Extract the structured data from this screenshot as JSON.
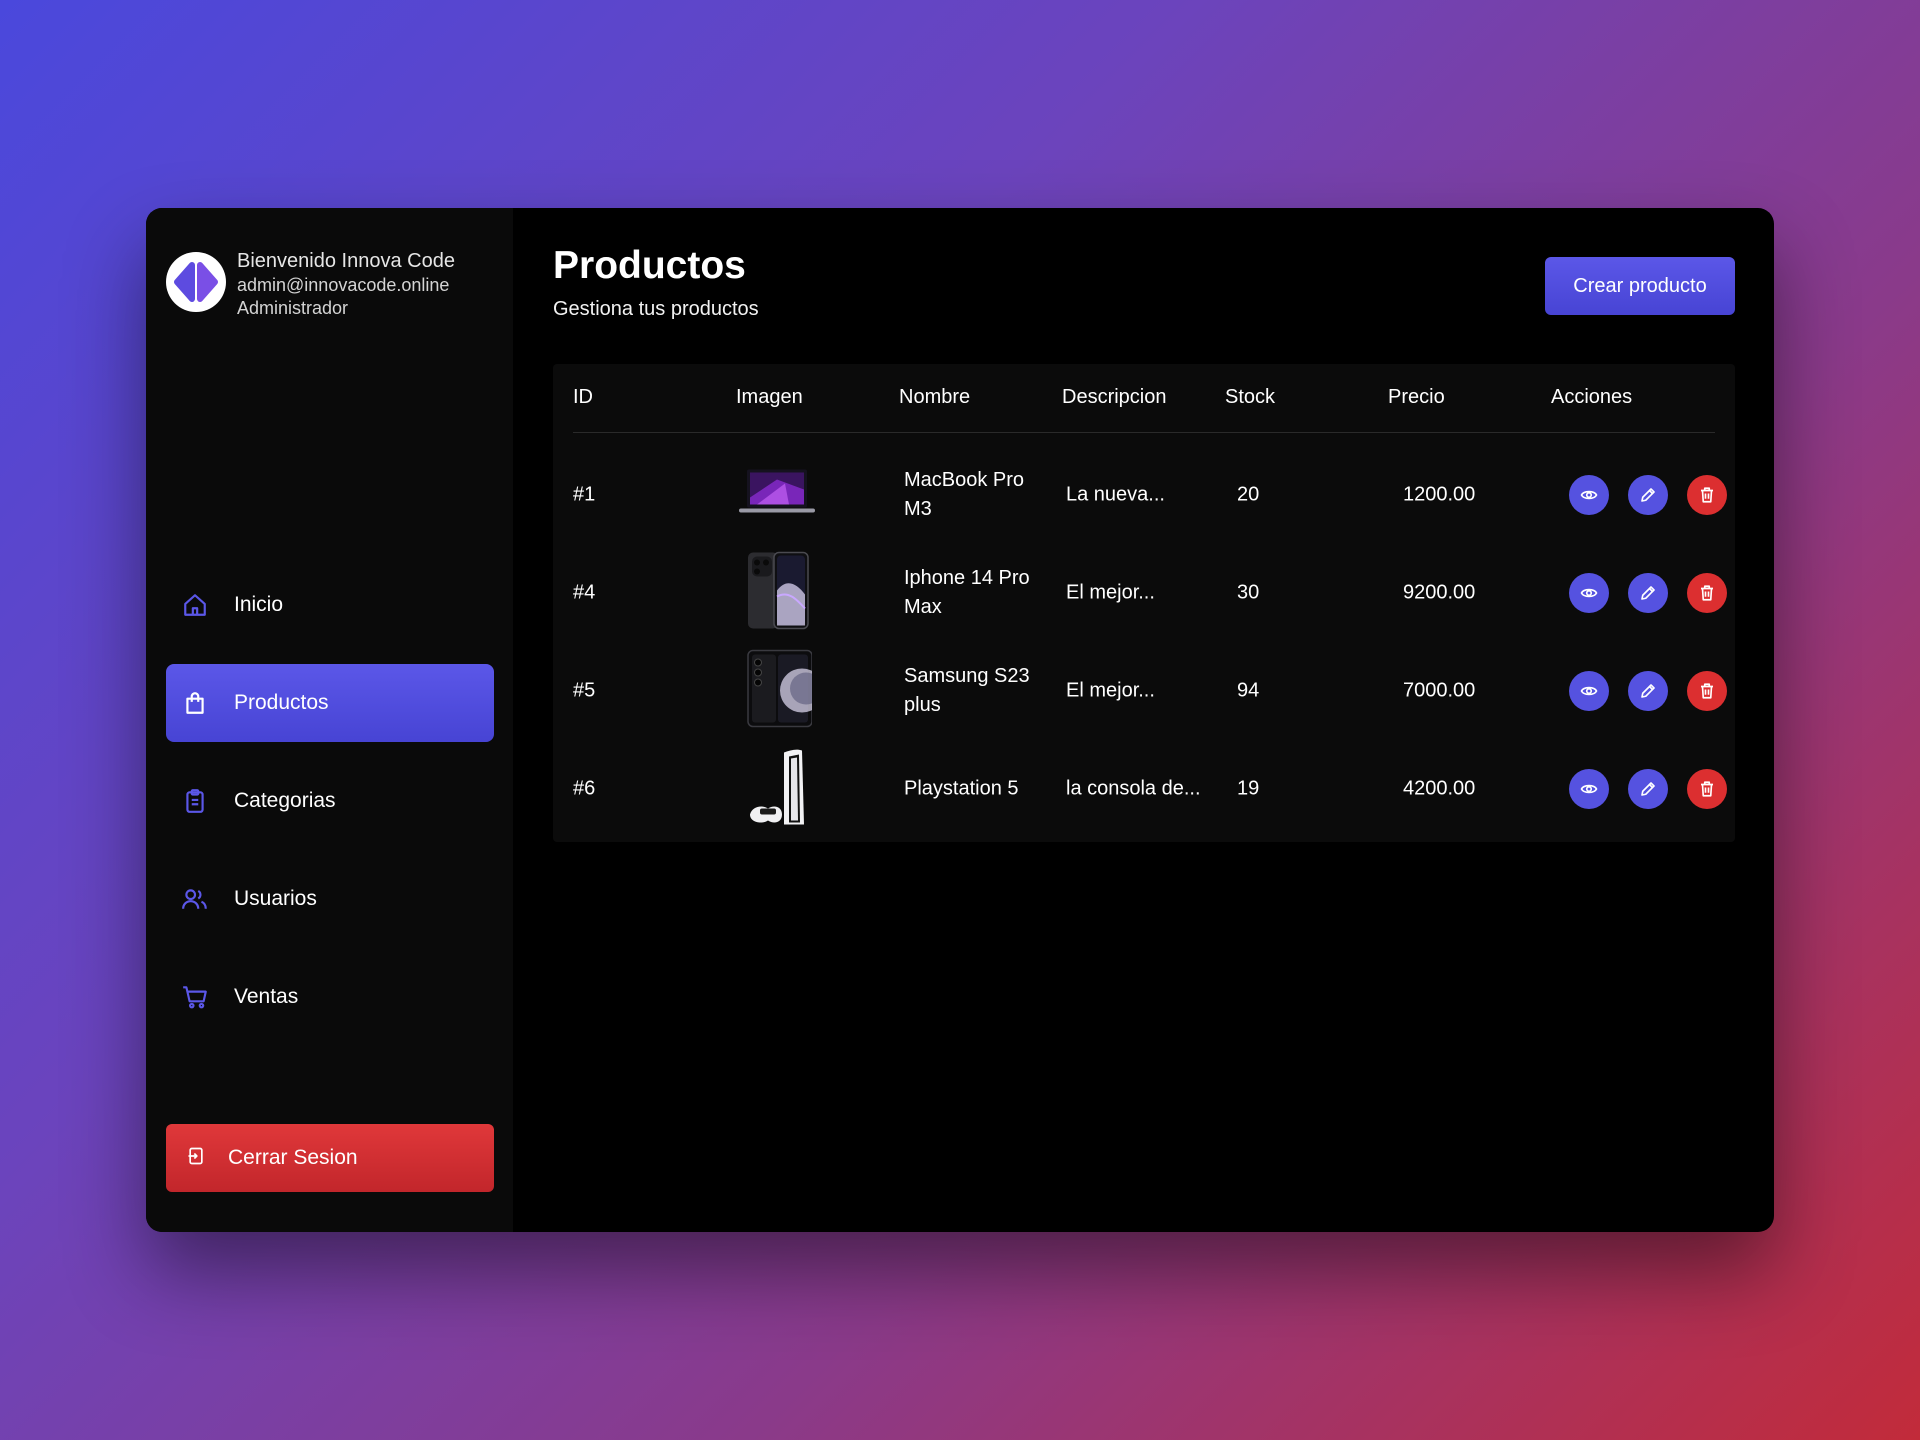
{
  "colors": {
    "accent": "#5552e0",
    "danger": "#dc2f30",
    "sidebar": "#0a0a0a",
    "main": "#000000"
  },
  "profile": {
    "welcome": "Bienvenido Innova Code",
    "email": "admin@innovacode.online",
    "role": "Administrador",
    "logo_icon": "innovacode-logo"
  },
  "sidebar": {
    "items": [
      {
        "label": "Inicio",
        "icon": "home-icon",
        "active": false
      },
      {
        "label": "Productos",
        "icon": "shopping-bag-icon",
        "active": true
      },
      {
        "label": "Categorias",
        "icon": "clipboard-icon",
        "active": false
      },
      {
        "label": "Usuarios",
        "icon": "users-icon",
        "active": false
      },
      {
        "label": "Ventas",
        "icon": "cart-icon",
        "active": false
      }
    ],
    "logout_label": "Cerrar Sesion"
  },
  "header": {
    "title": "Productos",
    "subtitle": "Gestiona tus productos",
    "create_label": "Crear producto"
  },
  "table": {
    "columns": [
      "ID",
      "Imagen",
      "Nombre",
      "Descripcion",
      "Stock",
      "Precio",
      "Acciones"
    ],
    "rows": [
      {
        "id": "#1",
        "name_line1": "MacBook Pro",
        "name_line2": "M3",
        "description": "La nueva...",
        "stock": "20",
        "price": "1200.00",
        "image": "laptop"
      },
      {
        "id": "#4",
        "name_line1": "Iphone 14 Pro",
        "name_line2": "Max",
        "description": "El mejor...",
        "stock": "30",
        "price": "9200.00",
        "image": "phone-iphone"
      },
      {
        "id": "#5",
        "name_line1": "Samsung S23",
        "name_line2": "plus",
        "description": "El mejor...",
        "stock": "94",
        "price": "7000.00",
        "image": "phone-samsung"
      },
      {
        "id": "#6",
        "name_line1": "Playstation 5",
        "name_line2": "",
        "description": "la consola de...",
        "stock": "19",
        "price": "4200.00",
        "image": "console"
      }
    ]
  }
}
